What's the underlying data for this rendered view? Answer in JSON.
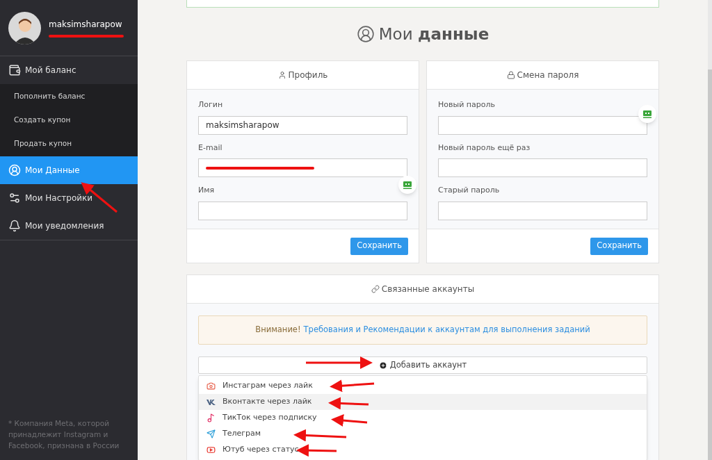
{
  "sidebar": {
    "user": {
      "name": "maksimsharapow"
    },
    "items": [
      {
        "label": "Мой баланс",
        "selected": false,
        "expanded": true,
        "children": [
          {
            "label": "Пополнить баланс"
          },
          {
            "label": "Создать купон"
          },
          {
            "label": "Продать купон"
          }
        ]
      },
      {
        "label": "Мои Данные",
        "selected": true
      },
      {
        "label": "Мои Настройки",
        "selected": false
      },
      {
        "label": "Мои уведомления",
        "selected": false
      }
    ],
    "footnote": "* Компания Meta, которой принадлежит Instagram и Facebook, признана в России"
  },
  "page_title": "Мои **данные**",
  "profile": {
    "title": "Профиль",
    "fields": [
      {
        "label": "Логин",
        "value": "maksimsharapow",
        "redacted": false
      },
      {
        "label": "E-mail",
        "redacted": true
      },
      {
        "label": "Имя",
        "redacted": false
      }
    ],
    "button": "Сохранить"
  },
  "password": {
    "title": "Смена пароля",
    "fields": [
      {
        "label": "Новый пароль"
      },
      {
        "label": "Новый пароль ещё раз"
      },
      {
        "label": "Старый пароль"
      }
    ],
    "button": "Сохранить"
  },
  "linked": {
    "title": "Связанные аккаунты",
    "notice_label": "Внимание!",
    "notice_link": "Требования и Рекомендации к аккаунтам для выполнения заданий",
    "add_button": "Добавить аккаунт",
    "menu": [
      {
        "kind": "instagram",
        "label": "Инстаграм через лайк",
        "selected": false
      },
      {
        "kind": "vk",
        "label": "Вконтакте через лайк",
        "selected": true
      },
      {
        "kind": "tiktok",
        "label": "ТикТок через подписку",
        "selected": false
      },
      {
        "kind": "telegram",
        "label": "Телеграм",
        "selected": false
      },
      {
        "kind": "youtube",
        "label": "Ютуб через статус",
        "selected": false
      }
    ]
  }
}
